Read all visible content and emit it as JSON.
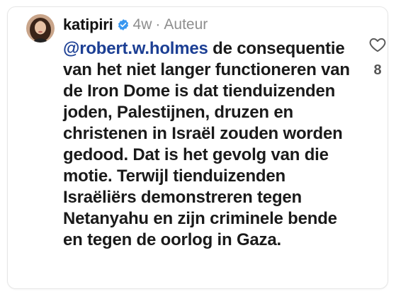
{
  "comment": {
    "username": "katipiri",
    "time_ago": "4w",
    "separator": "·",
    "role_label": "Auteur",
    "mention": "@robert.w.holmes",
    "text": " de consequentie van het niet langer functioneren van de Iron Dome is dat tienduizenden joden, Palestijnen, druzen en christenen in Israël zouden worden gedood. Dat is het gevolg van die motie. Terwijl tienduizenden Israëliërs demonstreren tegen Netanyahu en zijn criminele bende en tegen de oorlog in Gaza.",
    "like_count": "8",
    "icons": {
      "avatar": "avatar-photo",
      "verified": "verified-badge-icon",
      "like": "heart-outline-icon"
    }
  },
  "colors": {
    "mention": "#1c3f94",
    "verified": "#3897f0",
    "meta": "#8e8e8e",
    "text": "#1a1a1a"
  }
}
